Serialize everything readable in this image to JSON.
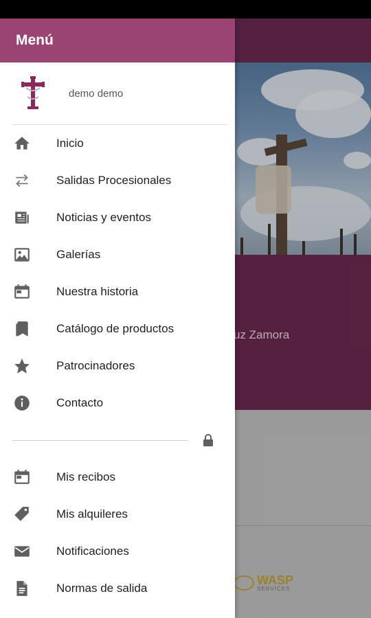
{
  "drawer": {
    "title": "Menú",
    "user_name": "demo demo",
    "items": [
      {
        "label": "Inicio",
        "icon": "home-icon"
      },
      {
        "label": "Salidas Procesionales",
        "icon": "swap-arrows-icon"
      },
      {
        "label": "Noticias y eventos",
        "icon": "newspaper-icon"
      },
      {
        "label": "Galerías",
        "icon": "image-gallery-icon"
      },
      {
        "label": "Nuestra historia",
        "icon": "calendar-icon"
      },
      {
        "label": "Catálogo de productos",
        "icon": "bookmarks-icon"
      },
      {
        "label": "Patrocinadores",
        "icon": "star-icon"
      },
      {
        "label": "Contacto",
        "icon": "info-icon"
      }
    ],
    "private_items": [
      {
        "label": "Mis recibos",
        "icon": "calendar-icon"
      },
      {
        "label": "Mis alquileres",
        "icon": "tag-icon"
      },
      {
        "label": "Notificaciones",
        "icon": "mail-icon"
      },
      {
        "label": "Normas de salida",
        "icon": "document-icon"
      }
    ]
  },
  "background": {
    "band_text": "uz Zamora",
    "logo_text": "WASP",
    "logo_subtext": "SERVICES"
  },
  "colors": {
    "drawer_header": "#9a4474",
    "app_bar": "#6f2a52",
    "icon": "#5f5f5f"
  }
}
